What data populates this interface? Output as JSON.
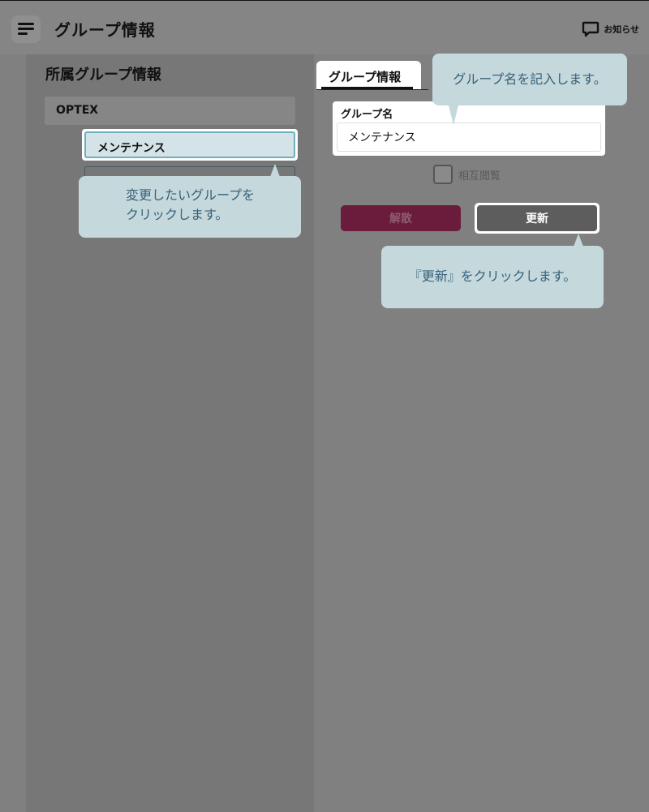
{
  "header": {
    "title": "グループ情報",
    "menu_icon": "hamburger-menu-icon",
    "notice_icon": "speech-bubble-icon",
    "notice_label": "お知らせ"
  },
  "left_panel": {
    "title": "所属グループ情報",
    "organization": "OPTEX",
    "groups": [
      {
        "label": "メンテナンス",
        "selected": true
      }
    ]
  },
  "detail": {
    "tab_label": "グループ情報",
    "group_name_label": "グループ名",
    "group_name_value": "メンテナンス",
    "mutual_view_label": "相互閲覧",
    "mutual_view_checked": false,
    "dissolve_label": "解散",
    "update_label": "更新"
  },
  "callouts": {
    "enter_name": "グループ名を記入します。",
    "select_group_line1": "変更したいグループを",
    "select_group_line2": "クリックします。",
    "click_update": "『更新』をクリックします。"
  },
  "colors": {
    "overlay": "#808080",
    "callout_bg": "#c5d8dc",
    "callout_text": "#35617a",
    "dissolve_button": "#6b1b3b",
    "update_button": "#5d5d5d",
    "selected_border": "#6fb0bb"
  }
}
